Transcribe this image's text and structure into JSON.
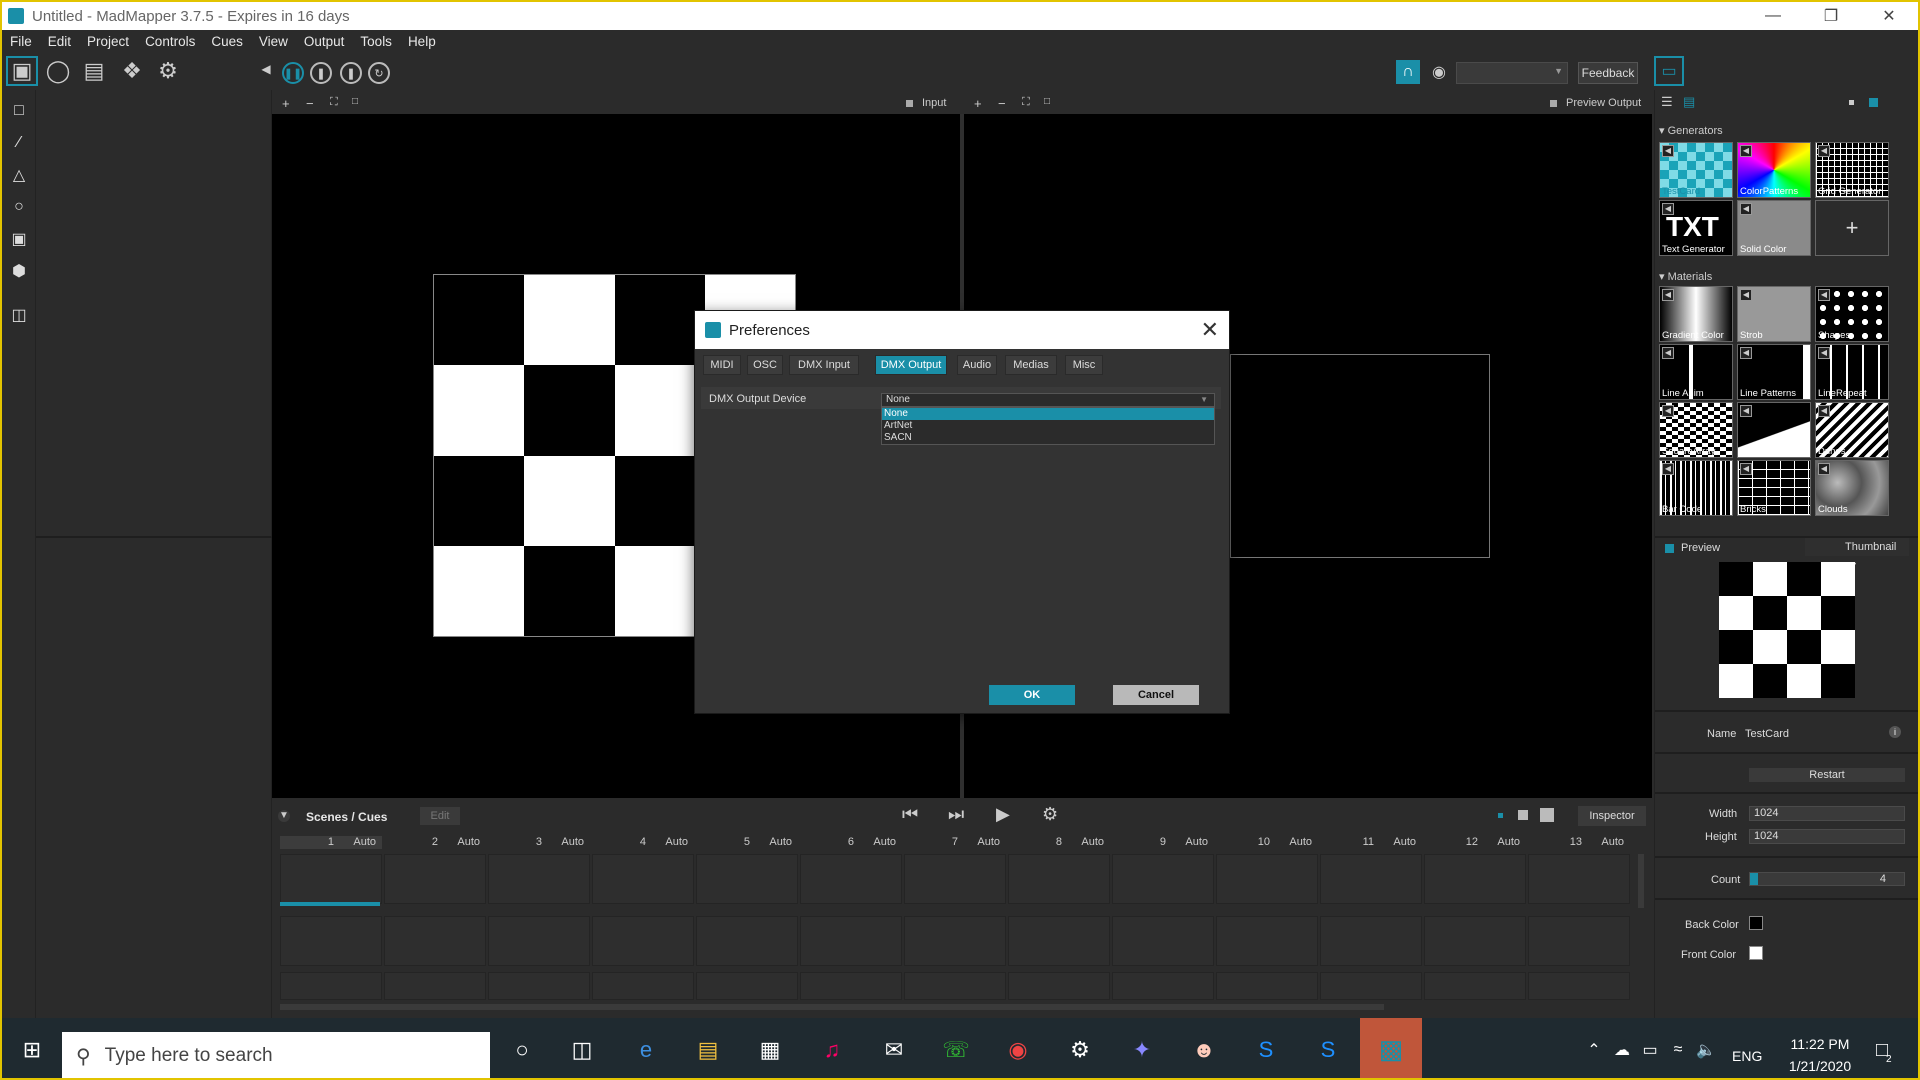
{
  "window": {
    "title": "Untitled - MadMapper 3.7.5 - Expires in 16 days"
  },
  "menu": [
    "File",
    "Edit",
    "Project",
    "Controls",
    "Cues",
    "View",
    "Output",
    "Tools",
    "Help"
  ],
  "toolbar": {
    "feedback_label": "Feedback"
  },
  "viewports": {
    "input_label": "Input",
    "output_label": "Preview Output"
  },
  "checker_pattern": [
    [
      0,
      1,
      0,
      1
    ],
    [
      1,
      0,
      1,
      0
    ],
    [
      0,
      1,
      0,
      1
    ],
    [
      1,
      0,
      1,
      0
    ]
  ],
  "cues": {
    "title": "Scenes / Cues",
    "edit_label": "Edit",
    "inspector_label": "Inspector",
    "columns": [
      {
        "num": "1",
        "mode": "Auto"
      },
      {
        "num": "2",
        "mode": "Auto"
      },
      {
        "num": "3",
        "mode": "Auto"
      },
      {
        "num": "4",
        "mode": "Auto"
      },
      {
        "num": "5",
        "mode": "Auto"
      },
      {
        "num": "6",
        "mode": "Auto"
      },
      {
        "num": "7",
        "mode": "Auto"
      },
      {
        "num": "8",
        "mode": "Auto"
      },
      {
        "num": "9",
        "mode": "Auto"
      },
      {
        "num": "10",
        "mode": "Auto"
      },
      {
        "num": "11",
        "mode": "Auto"
      },
      {
        "num": "12",
        "mode": "Auto"
      },
      {
        "num": "13",
        "mode": "Auto"
      }
    ]
  },
  "library": {
    "generators_title": "Generators",
    "generators": [
      "TestCard",
      "ColorPatterns",
      "Grid Generator",
      "Text Generator",
      "Solid Color"
    ],
    "materials_title": "Materials",
    "materials": [
      "Gradient Color",
      "Strob",
      "Shapes",
      "Line Anim",
      "Line Patterns",
      "LineRepeat",
      "SquareArray",
      "Siren",
      "Dunes",
      "Bar Code",
      "Bricks",
      "Clouds"
    ]
  },
  "inspector": {
    "preview_label": "Preview",
    "view_mode": "Thumbnail",
    "name_label": "Name",
    "name_value": "TestCard",
    "restart_label": "Restart",
    "width_label": "Width",
    "width_value": "1024",
    "height_label": "Height",
    "height_value": "1024",
    "count_label": "Count",
    "count_value": "4",
    "back_color_label": "Back Color",
    "back_color": "#000000",
    "front_color_label": "Front Color",
    "front_color": "#ffffff"
  },
  "dialog": {
    "title": "Preferences",
    "tabs": [
      "MIDI",
      "OSC",
      "DMX Input",
      "DMX Output",
      "Audio",
      "Medias",
      "Misc"
    ],
    "active_tab": "DMX Output",
    "dmx_device_label": "DMX Output Device",
    "dmx_device_value": "None",
    "dmx_options": [
      "None",
      "ArtNet",
      "SACN"
    ],
    "ok_label": "OK",
    "cancel_label": "Cancel"
  },
  "taskbar": {
    "search_placeholder": "Type here to search",
    "language": "ENG",
    "time": "11:22 PM",
    "date": "1/21/2020",
    "notification_count": "2"
  },
  "colors": {
    "accent": "#1a8fa8",
    "window_border": "#e2c400"
  }
}
